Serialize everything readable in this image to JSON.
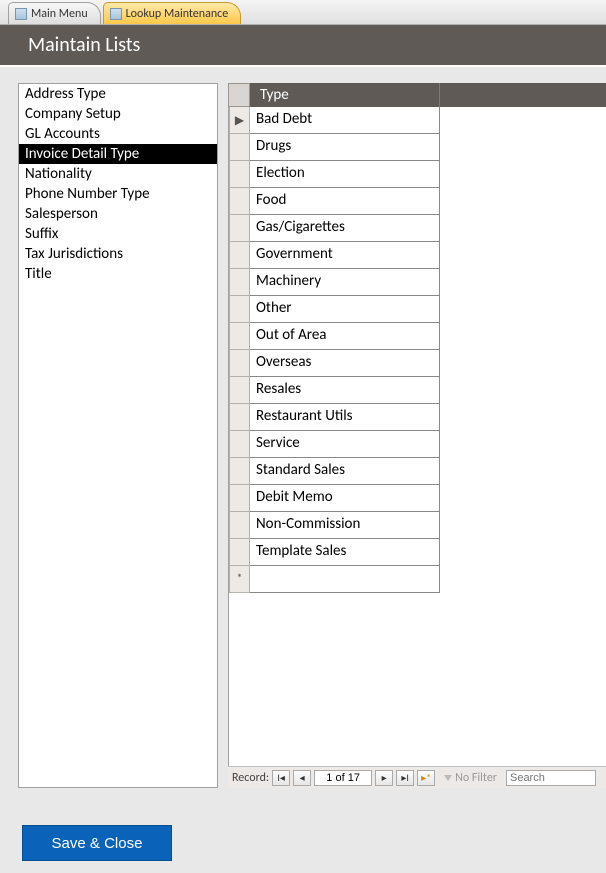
{
  "tabs": {
    "inactive": "Main Menu",
    "active": "Lookup Maintenance"
  },
  "header": {
    "title": "Maintain Lists"
  },
  "listPanel": {
    "items": [
      "Address Type",
      "Company Setup",
      "GL Accounts",
      "Invoice Detail Type",
      "Nationality",
      "Phone Number Type",
      "Salesperson",
      "Suffix",
      "Tax Jurisdictions",
      "Title"
    ],
    "selectedIndex": 3
  },
  "grid": {
    "columnHeader": "Type",
    "rows": [
      "Bad Debt",
      "Drugs",
      "Election",
      "Food",
      "Gas/Cigarettes",
      "Government",
      "Machinery",
      "Other",
      "Out of Area",
      "Overseas",
      "Resales",
      "Restaurant Utils",
      "Service",
      "Standard Sales",
      "Debit Memo",
      "Non-Commission",
      "Template Sales"
    ],
    "currentMarker": "▶",
    "newMarker": "*"
  },
  "recordNav": {
    "label": "Record:",
    "position": "1 of 17",
    "noFilter": "No Filter",
    "searchPlaceholder": "Search"
  },
  "footer": {
    "saveClose": "Save & Close"
  }
}
